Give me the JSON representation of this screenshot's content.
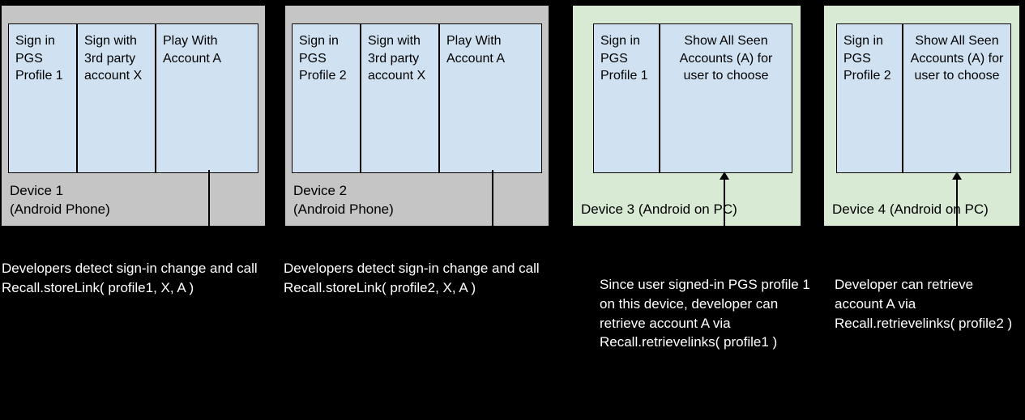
{
  "devices": [
    {
      "label": "Device 1\n(Android Phone)",
      "cells": [
        "Sign in PGS Profile 1",
        "Sign with 3rd party account X",
        "Play With Account A"
      ]
    },
    {
      "label": "Device 2\n(Android Phone)",
      "cells": [
        "Sign in PGS Profile 2",
        "Sign with 3rd party account X",
        "Play With Account A"
      ]
    },
    {
      "label": "Device 3 (Android on PC)",
      "cells": [
        "Sign in PGS Profile 1",
        "Show All Seen Accounts (A) for user to choose"
      ]
    },
    {
      "label": "Device 4 (Android on PC)",
      "cells": [
        "Sign in PGS Profile 2",
        "Show All Seen Accounts (A) for user to choose"
      ]
    }
  ],
  "captions": {
    "c1": "Developers detect sign-in change and call\nRecall.storeLink( profile1, X, A )",
    "c2": "Developers detect sign-in change and call\nRecall.storeLink( profile2, X, A )",
    "c3": "Since user signed-in PGS profile 1 on this device, developer can retrieve account A via Recall.retrievelinks( profile1 )",
    "c4": "Developer can retrieve account A via Recall.retrievelinks( profile2 )"
  }
}
